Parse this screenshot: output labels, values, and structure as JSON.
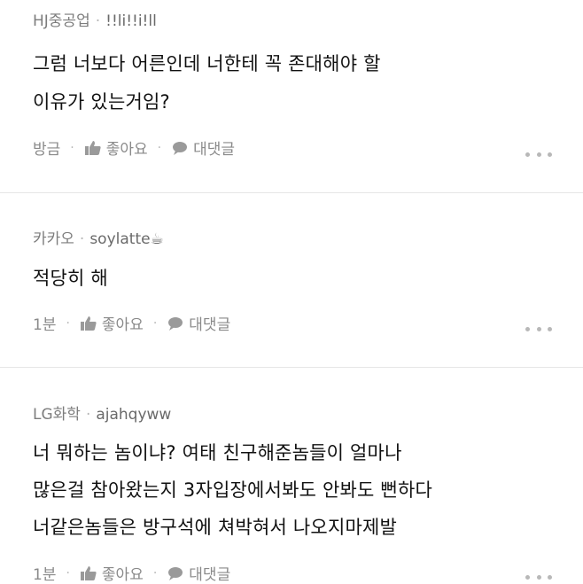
{
  "comments": [
    {
      "author": "HJ중공업",
      "nickname": "!!li!!i!ll",
      "lines": [
        "그럼 너보다 어른인데 너한테 꼭 존대해야 할",
        "이유가 있는거임?"
      ],
      "time": "방금",
      "like_label": "좋아요",
      "reply_label": "대댓글"
    },
    {
      "author": "카카오",
      "nickname": "soylatte☕",
      "lines": [
        "적당히 해"
      ],
      "time": "1분",
      "like_label": "좋아요",
      "reply_label": "대댓글"
    },
    {
      "author": "LG화학",
      "nickname": "ajahqyww",
      "lines": [
        "너 뭐하는 놈이냐? 여태 친구해준놈들이 얼마나",
        "많은걸 참아왔는지 3자입장에서봐도 안봐도 뻔하다",
        "너같은놈들은 방구석에 쳐박혀서 나오지마제발"
      ],
      "time": "1분",
      "like_label": "좋아요",
      "reply_label": "대댓글"
    }
  ],
  "meta_separator": "·",
  "icons": {
    "like": "thumbs-up-icon",
    "reply": "speech-bubble-icon",
    "more": "more-dots-icon"
  },
  "colors": {
    "meta": "#7d7d7d",
    "body": "#111111",
    "separator": "#e6e6e6"
  }
}
